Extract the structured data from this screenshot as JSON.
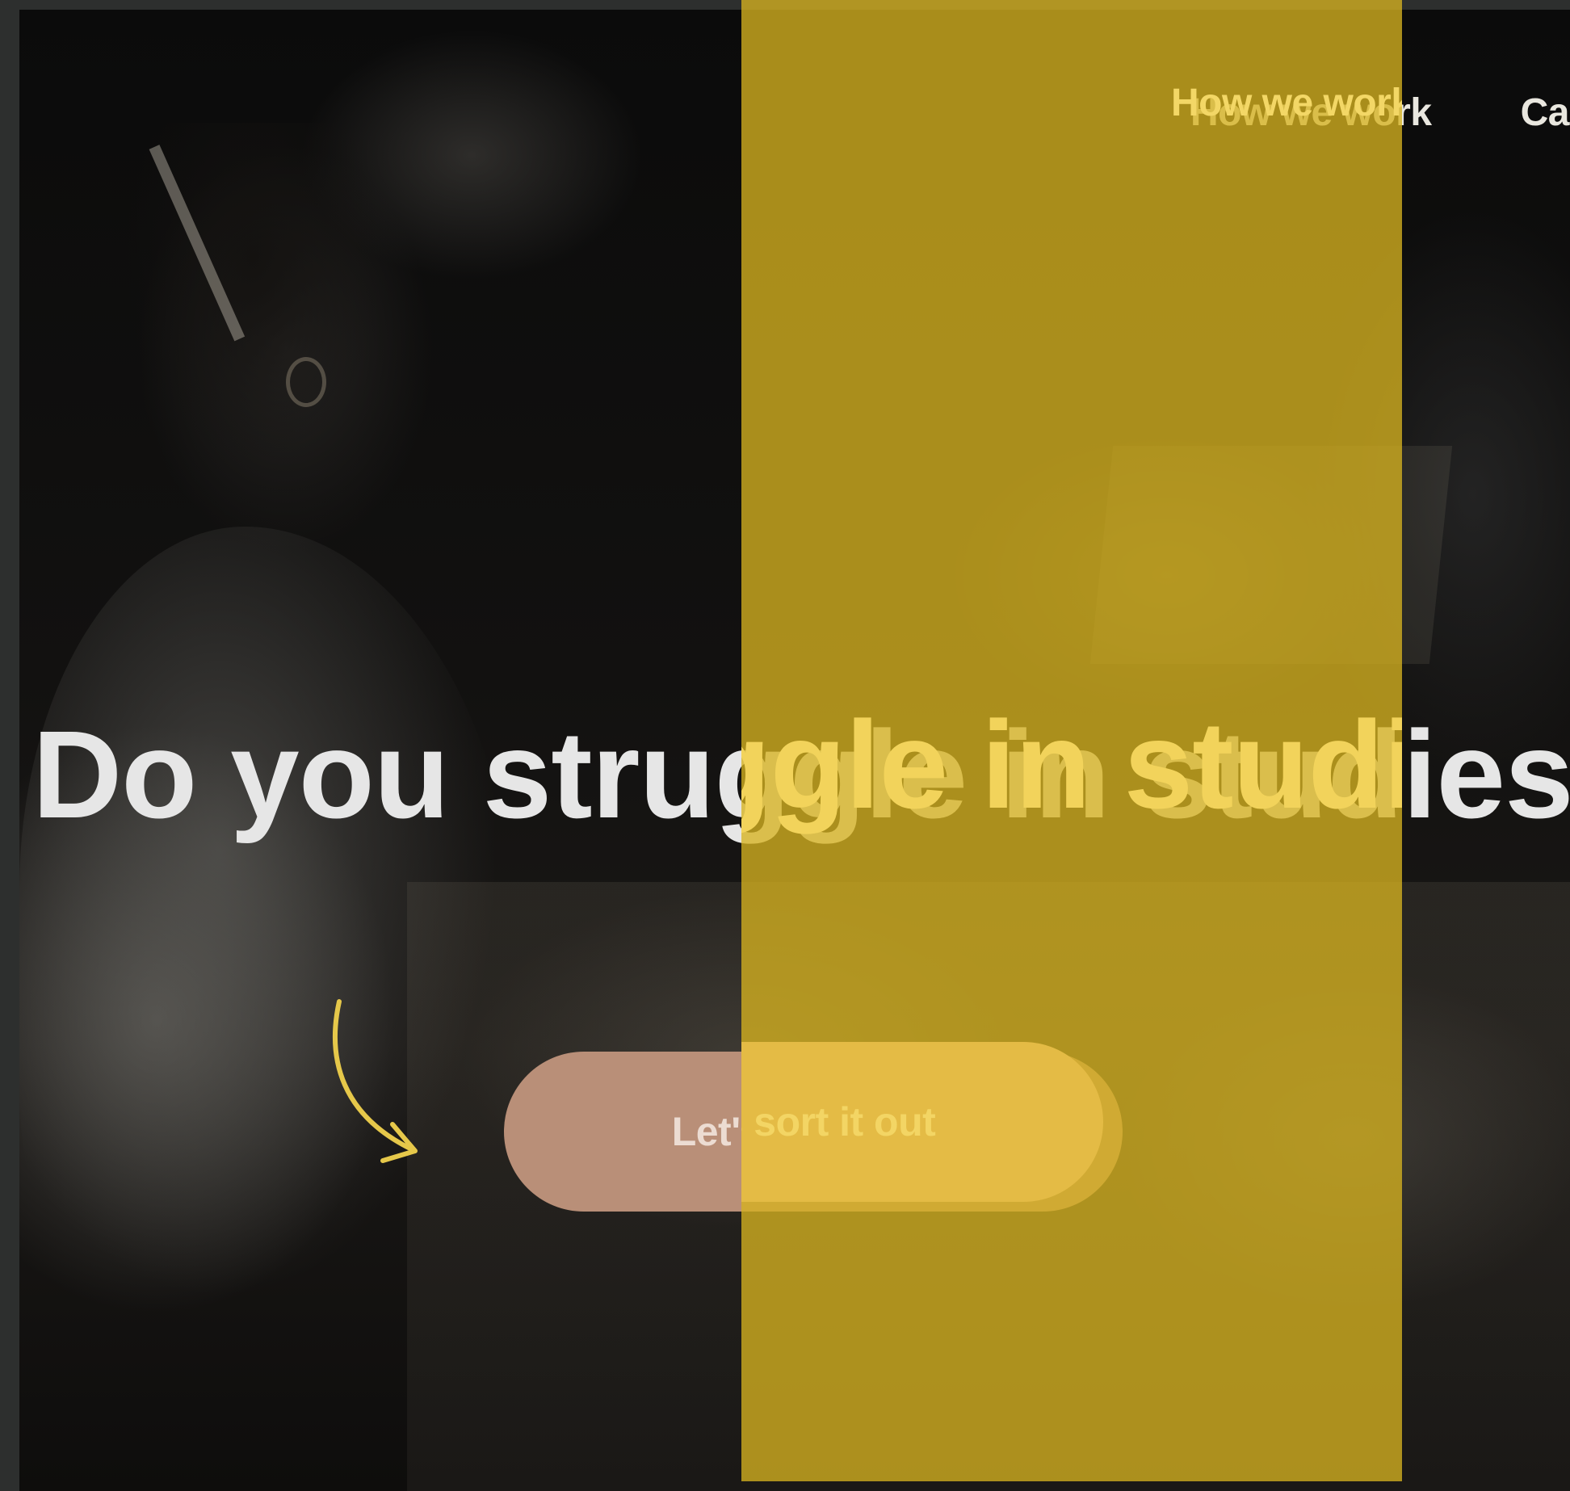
{
  "nav": {
    "items": [
      {
        "label": "How we work"
      },
      {
        "label": "Ca"
      }
    ]
  },
  "hero": {
    "headline": "Do you struggle in studies?",
    "cta_label": "Let's sort it out"
  },
  "colors": {
    "overlay_yellow": "#d6b220",
    "cta_bg": "#b98f78",
    "cta_bg_in_stripe": "#e4bb45",
    "arrow": "#e6c84a",
    "headline": "#e6e6e6"
  },
  "icons": {
    "arrow": "curved-arrow-icon"
  }
}
